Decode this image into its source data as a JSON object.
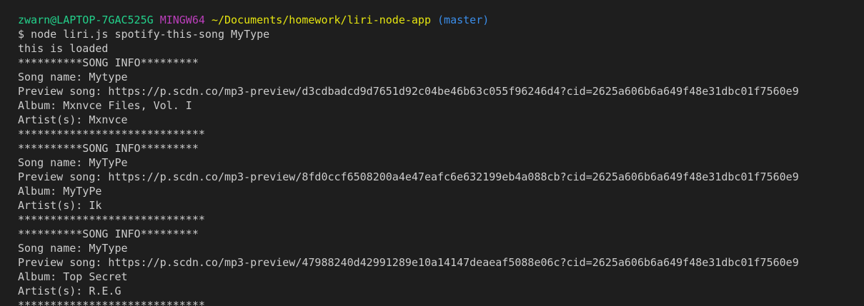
{
  "prompt": {
    "user_host": "zwarn@LAPTOP-7GAC525G",
    "shell": "MINGW64",
    "path": "~/Documents/homework/liri-node-app",
    "branch": "(master)"
  },
  "command": "$ node liri.js spotify-this-song MyType",
  "loaded": "this is loaded",
  "songs": [
    {
      "header": "**********SONG INFO*********",
      "name": "Song name: Mytype",
      "preview": "Preview song: https://p.scdn.co/mp3-preview/d3cdbadcd9d7651d92c04be46b63c055f96246d4?cid=2625a606b6a649f48e31dbc01f7560e9",
      "album": "Album: Mxnvce Files, Vol. I",
      "artist": "Artist(s): Mxnvce",
      "footer": "*****************************"
    },
    {
      "header": "**********SONG INFO*********",
      "name": "Song name: MyTyPe",
      "preview": "Preview song: https://p.scdn.co/mp3-preview/8fd0ccf6508200a4e47eafc6e632199eb4a088cb?cid=2625a606b6a649f48e31dbc01f7560e9",
      "album": "Album: MyTyPe",
      "artist": "Artist(s): Ik",
      "footer": "*****************************"
    },
    {
      "header": "**********SONG INFO*********",
      "name": "Song name: MyType",
      "preview": "Preview song: https://p.scdn.co/mp3-preview/47988240d42991289e10a14147deaeaf5088e06c?cid=2625a606b6a649f48e31dbc01f7560e9",
      "album": "Album: Top Secret",
      "artist": "Artist(s): R.E.G",
      "footer": "*****************************"
    }
  ],
  "colors": {
    "background": "#1e1e1e",
    "text": "#cccccc",
    "user_host": "#23d18b",
    "shell": "#bc3fbc",
    "path": "#e5e510",
    "branch": "#3b8eea"
  }
}
